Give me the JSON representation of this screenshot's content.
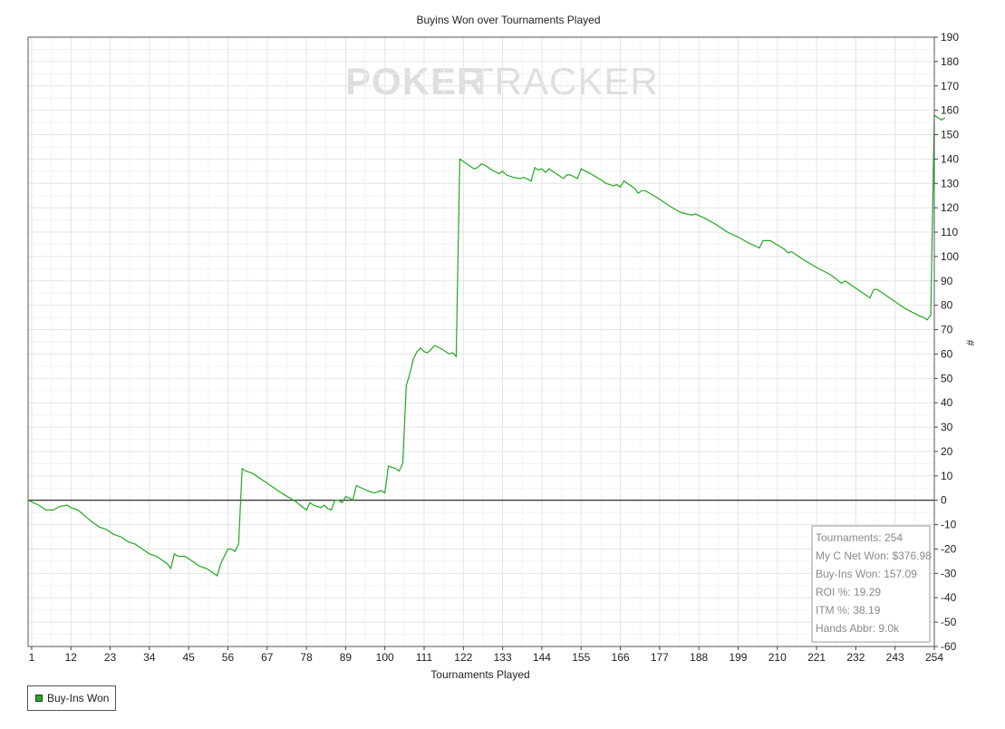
{
  "brand": {
    "logo_text_poker": "POKER",
    "logo_text_tracker": "TRACKER"
  },
  "colors": {
    "series": "#22a822",
    "zero_line": "#000000",
    "grid": "#e6e6e6",
    "axis": "#444444",
    "stats_text": "#8a8a8a",
    "watermark": "#dcdcdc"
  },
  "stats": [
    "Tournaments: 254",
    "My C Net Won: $376.98",
    "Buy-Ins Won: 157.09",
    "ROI %: 19.29",
    "ITM %: 38.19",
    "Hands Abbr: 9.0k"
  ],
  "legend": {
    "label": "Buy-Ins Won",
    "color": "#22a822"
  },
  "chart_data": {
    "type": "line",
    "title": "Buyins Won over Tournaments Played",
    "xlabel": "Tournaments Played",
    "ylabel": "#",
    "xlim": [
      0,
      254
    ],
    "ylim": [
      -60,
      190
    ],
    "x_ticks": [
      1,
      12,
      23,
      34,
      45,
      56,
      67,
      78,
      89,
      100,
      111,
      122,
      133,
      144,
      155,
      166,
      177,
      188,
      199,
      210,
      221,
      232,
      243,
      254
    ],
    "y_ticks": [
      190,
      180,
      170,
      160,
      150,
      140,
      130,
      120,
      110,
      100,
      90,
      80,
      70,
      60,
      50,
      40,
      30,
      20,
      10,
      0,
      -10,
      -20,
      -30,
      -40,
      -50,
      -60
    ],
    "y_axis_side": "right",
    "grid": true,
    "legend_position": "bottom-left",
    "series": [
      {
        "name": "Buy-Ins Won",
        "points": [
          [
            0,
            0
          ],
          [
            3,
            -2
          ],
          [
            5,
            -4
          ],
          [
            7,
            -4
          ],
          [
            9,
            -2.5
          ],
          [
            11,
            -2
          ],
          [
            12,
            -3
          ],
          [
            14,
            -4
          ],
          [
            18,
            -9
          ],
          [
            20,
            -11
          ],
          [
            22,
            -12
          ],
          [
            24,
            -14
          ],
          [
            26,
            -15
          ],
          [
            28,
            -17
          ],
          [
            30,
            -18
          ],
          [
            32,
            -20
          ],
          [
            34,
            -22
          ],
          [
            36,
            -23
          ],
          [
            39,
            -26
          ],
          [
            40,
            -28
          ],
          [
            41,
            -22
          ],
          [
            42,
            -23
          ],
          [
            44,
            -23
          ],
          [
            46,
            -25
          ],
          [
            48,
            -27
          ],
          [
            50,
            -28
          ],
          [
            52,
            -30
          ],
          [
            53,
            -31
          ],
          [
            54,
            -26
          ],
          [
            56,
            -20
          ],
          [
            57,
            -20
          ],
          [
            58,
            -21
          ],
          [
            59,
            -18
          ],
          [
            60,
            13
          ],
          [
            61,
            12
          ],
          [
            63,
            11
          ],
          [
            67,
            7
          ],
          [
            71,
            3
          ],
          [
            75,
            -0.5
          ],
          [
            78,
            -4
          ],
          [
            79,
            -1
          ],
          [
            80,
            -2
          ],
          [
            82,
            -3
          ],
          [
            83,
            -2
          ],
          [
            84,
            -3.5
          ],
          [
            85,
            -4
          ],
          [
            86,
            0
          ],
          [
            87,
            0
          ],
          [
            88,
            -1
          ],
          [
            89,
            1.5
          ],
          [
            90,
            1
          ],
          [
            91,
            0
          ],
          [
            92,
            6
          ],
          [
            95,
            4
          ],
          [
            97,
            3
          ],
          [
            99,
            4
          ],
          [
            100,
            3
          ],
          [
            101,
            14
          ],
          [
            103,
            13
          ],
          [
            104,
            12
          ],
          [
            105,
            15
          ],
          [
            106,
            47
          ],
          [
            107,
            52
          ],
          [
            108,
            58
          ],
          [
            109,
            61
          ],
          [
            110,
            62.5
          ],
          [
            111,
            61
          ],
          [
            112,
            60.5
          ],
          [
            113,
            62
          ],
          [
            114,
            63.5
          ],
          [
            116,
            62
          ],
          [
            118,
            60
          ],
          [
            119,
            60.5
          ],
          [
            120,
            59
          ],
          [
            121,
            140
          ],
          [
            123,
            138
          ],
          [
            125,
            136
          ],
          [
            126,
            136.5
          ],
          [
            127,
            138
          ],
          [
            128,
            137.5
          ],
          [
            130,
            135.5
          ],
          [
            132,
            134
          ],
          [
            133,
            135
          ],
          [
            134,
            133.5
          ],
          [
            136,
            132.5
          ],
          [
            138,
            132
          ],
          [
            139,
            132.5
          ],
          [
            141,
            131
          ],
          [
            142,
            136.5
          ],
          [
            143,
            135.5
          ],
          [
            144,
            136
          ],
          [
            145,
            134.5
          ],
          [
            146,
            136
          ],
          [
            148,
            134
          ],
          [
            150,
            132
          ],
          [
            151,
            133.5
          ],
          [
            152,
            133.5
          ],
          [
            154,
            132
          ],
          [
            155,
            136
          ],
          [
            157,
            134.5
          ],
          [
            160,
            132
          ],
          [
            162,
            130
          ],
          [
            163,
            129.5
          ],
          [
            164,
            129
          ],
          [
            165,
            129.5
          ],
          [
            166,
            128.5
          ],
          [
            167,
            131
          ],
          [
            170,
            128
          ],
          [
            171,
            126
          ],
          [
            172,
            127
          ],
          [
            173,
            127
          ],
          [
            176,
            124.5
          ],
          [
            180,
            120.5
          ],
          [
            183,
            118
          ],
          [
            186,
            117
          ],
          [
            187,
            117.5
          ],
          [
            190,
            115.5
          ],
          [
            193,
            113
          ],
          [
            196,
            110
          ],
          [
            199,
            108
          ],
          [
            202,
            105.5
          ],
          [
            205,
            103.5
          ],
          [
            206,
            106.5
          ],
          [
            208,
            106.5
          ],
          [
            212,
            103
          ],
          [
            213,
            101.5
          ],
          [
            214,
            102
          ],
          [
            217,
            99
          ],
          [
            221,
            95.5
          ],
          [
            225,
            92.5
          ],
          [
            228,
            89
          ],
          [
            229,
            90
          ],
          [
            230,
            89
          ],
          [
            232,
            87
          ],
          [
            236,
            83
          ],
          [
            237,
            86.5
          ],
          [
            238,
            86.5
          ],
          [
            242,
            82.5
          ],
          [
            246,
            78.5
          ],
          [
            250,
            75.5
          ],
          [
            251,
            75
          ],
          [
            252,
            74
          ],
          [
            253,
            76
          ],
          [
            254,
            158
          ],
          [
            256,
            156
          ],
          [
            257,
            157
          ]
        ]
      }
    ]
  }
}
